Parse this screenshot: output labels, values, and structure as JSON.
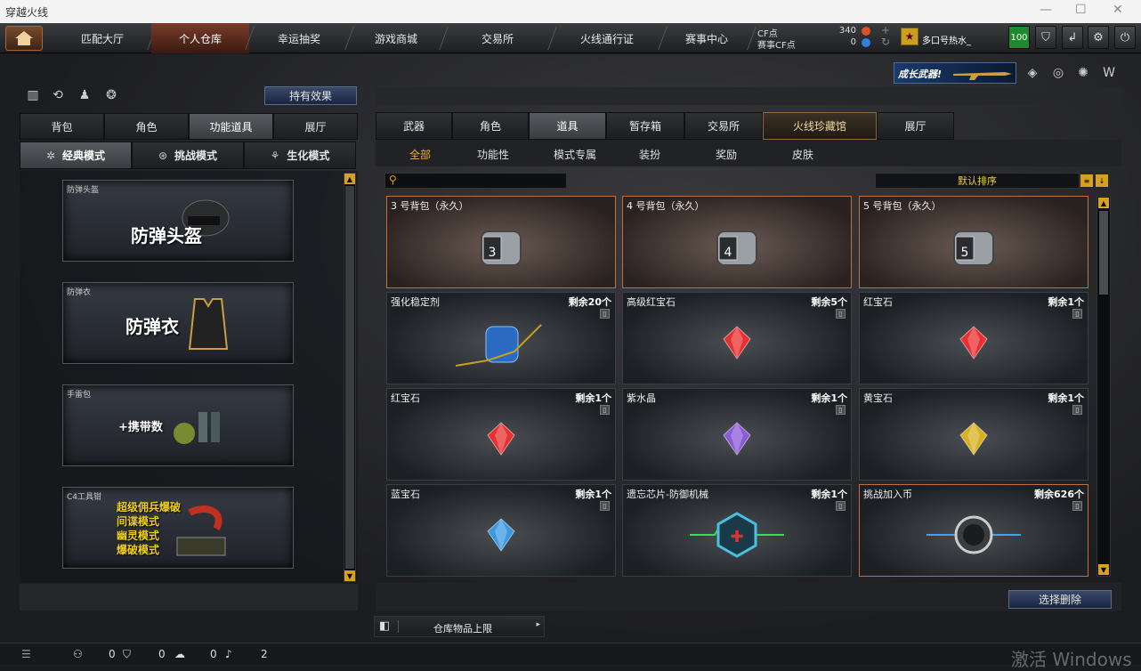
{
  "window": {
    "title": "穿越火线"
  },
  "nav": {
    "tabs": [
      "匹配大厅",
      "个人仓库",
      "幸运抽奖",
      "游戏商城",
      "交易所",
      "火线通行证",
      "赛事中心"
    ],
    "active_index": 1
  },
  "currency": {
    "cf_label": "CF点",
    "cf_value": "340",
    "match_cf_label": "赛事CF点",
    "match_cf_value": "0"
  },
  "user": {
    "name": "多口号热水_",
    "level": "100"
  },
  "banner": {
    "text": "成长武器!"
  },
  "left": {
    "effect_button": "持有效果",
    "tabs": [
      "背包",
      "角色",
      "功能道具",
      "展厅"
    ],
    "active_tab": 2,
    "modes": [
      "经典模式",
      "挑战模式",
      "生化模式"
    ],
    "cards": [
      {
        "label": "防弹头盔",
        "big": "防弹头盔"
      },
      {
        "label": "防弹衣",
        "big": "防弹衣"
      },
      {
        "label": "手雷包",
        "big": "+携带数"
      },
      {
        "label": "C4工具钳",
        "lines": [
          "超级佣兵爆破",
          "间谍模式",
          "幽灵模式",
          "爆破模式"
        ]
      }
    ]
  },
  "right": {
    "tabs": [
      "武器",
      "角色",
      "道具",
      "暂存箱",
      "交易所",
      "火线珍藏馆",
      "展厅"
    ],
    "active_tab": 2,
    "subtabs": [
      "全部",
      "功能性",
      "模式专属",
      "装扮",
      "奖励",
      "皮肤"
    ],
    "active_subtab": 0,
    "sort_label": "默认排序",
    "items": [
      {
        "name": "3 号背包（永久）",
        "count": "",
        "bag": "3"
      },
      {
        "name": "4 号背包（永久）",
        "count": "",
        "bag": "4"
      },
      {
        "name": "5 号背包（永久）",
        "count": "",
        "bag": "5"
      },
      {
        "name": "强化稳定剂",
        "count": "剩余20个",
        "icon": "stabilizer"
      },
      {
        "name": "高级红宝石",
        "count": "剩余5个",
        "gem": "#e83030"
      },
      {
        "name": "红宝石",
        "count": "剩余1个",
        "gem": "#e83030"
      },
      {
        "name": "红宝石",
        "count": "剩余1个",
        "gem": "#e83030"
      },
      {
        "name": "紫水晶",
        "count": "剩余1个",
        "gem": "#8a5ad8"
      },
      {
        "name": "黄宝石",
        "count": "剩余1个",
        "gem": "#d8b020"
      },
      {
        "name": "蓝宝石",
        "count": "剩余1个",
        "gem": "#3a9ae0"
      },
      {
        "name": "遗忘芯片-防御机械",
        "count": "剩余1个",
        "icon": "chip"
      },
      {
        "name": "挑战加入币",
        "count": "剩余626个",
        "icon": "coin"
      }
    ],
    "delete_button": "选择删除",
    "capacity_label": "仓库物品上限"
  },
  "status": {
    "v1": "0",
    "v2": "0",
    "v3": "0",
    "v4": "2"
  },
  "watermark": "激活 Windows"
}
